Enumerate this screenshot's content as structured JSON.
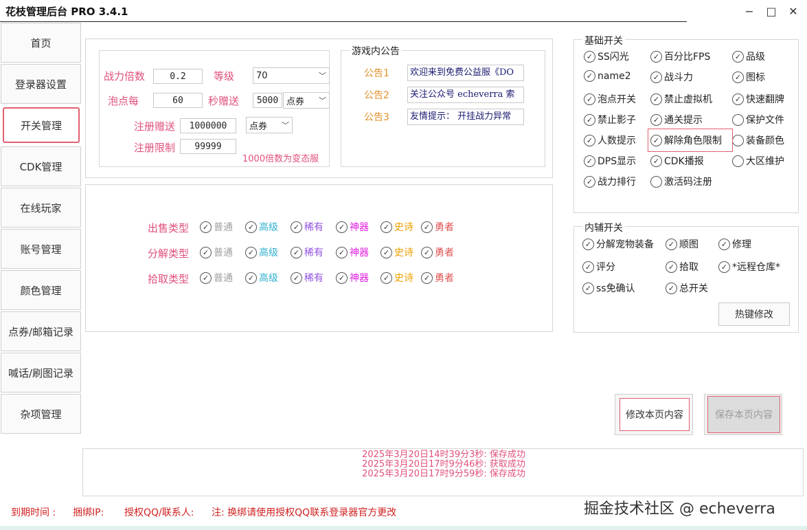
{
  "window": {
    "title": "花枝管理后台 PRO 3.4.1",
    "min": "−",
    "max": "□",
    "close": "✕"
  },
  "nav": [
    "首页",
    "登录器设置",
    "开关管理",
    "CDK管理",
    "在线玩家",
    "账号管理",
    "颜色管理",
    "点券/邮箱记录",
    "喊话/刷图记录",
    "杂项管理"
  ],
  "settings": {
    "power_mult_label": "战力倍数",
    "power_mult_value": "0.2",
    "level_label": "等级",
    "level_value": "70",
    "bubble_label": "泡点每",
    "bubble_value": "60",
    "per_sec_label": "秒赠送",
    "per_sec_value": "5000",
    "currency_value": "点券",
    "reg_gift_label": "注册赠送",
    "reg_gift_value": "1000000",
    "reg_currency_value": "点券",
    "reg_limit_label": "注册限制",
    "reg_limit_value": "99999",
    "hint": "1000倍数为变态服"
  },
  "announce": {
    "title": "游戏内公告",
    "items": [
      {
        "label": "公告1",
        "value": "欢迎来到免费公益服《DO"
      },
      {
        "label": "公告2",
        "value": "关注公众号 echeverra 索"
      },
      {
        "label": "公告3",
        "value": "友情提示： 开挂战力异常"
      }
    ]
  },
  "types": {
    "rows": [
      "出售类型",
      "分解类型",
      "拾取类型"
    ],
    "options": [
      {
        "label": "普通",
        "color": "#a0a0a0"
      },
      {
        "label": "高级",
        "color": "#30b0d0"
      },
      {
        "label": "稀有",
        "color": "#9050e0"
      },
      {
        "label": "神器",
        "color": "#e020e0"
      },
      {
        "label": "史诗",
        "color": "#f0a000"
      },
      {
        "label": "勇者",
        "color": "#e05050"
      }
    ]
  },
  "basic": {
    "title": "基础开关",
    "items": [
      {
        "label": "SS闪光",
        "checked": true
      },
      {
        "label": "百分比FPS",
        "checked": true
      },
      {
        "label": "品级",
        "checked": true
      },
      {
        "label": "name2",
        "checked": true
      },
      {
        "label": "战斗力",
        "checked": true
      },
      {
        "label": "图标",
        "checked": true
      },
      {
        "label": "泡点开关",
        "checked": true
      },
      {
        "label": "禁止虚拟机",
        "checked": true
      },
      {
        "label": "快速翻牌",
        "checked": true
      },
      {
        "label": "禁止影子",
        "checked": true
      },
      {
        "label": "通关提示",
        "checked": true
      },
      {
        "label": "保护文件",
        "checked": false
      },
      {
        "label": "人数提示",
        "checked": true
      },
      {
        "label": "解除角色限制",
        "checked": true
      },
      {
        "label": "装备颜色",
        "checked": false
      },
      {
        "label": "DPS显示",
        "checked": true
      },
      {
        "label": "CDK播报",
        "checked": true
      },
      {
        "label": "大区维护",
        "checked": false
      },
      {
        "label": "战力排行",
        "checked": true
      },
      {
        "label": "激活码注册",
        "checked": false
      }
    ]
  },
  "aux": {
    "title": "内辅开关",
    "items": [
      {
        "label": "分解宠物装备",
        "checked": true
      },
      {
        "label": "顺图",
        "checked": true
      },
      {
        "label": "修理",
        "checked": true
      },
      {
        "label": "评分",
        "checked": true
      },
      {
        "label": "拾取",
        "checked": true
      },
      {
        "label": "*远程仓库*",
        "checked": true
      },
      {
        "label": "ss免确认",
        "checked": true
      },
      {
        "label": "总开关",
        "checked": true
      }
    ],
    "hotkey_button": "热键修改"
  },
  "actions": {
    "modify": "修改本页内容",
    "save": "保存本页内容"
  },
  "log": [
    "2025年3月20日14时39分3秒: 保存成功",
    "2025年3月20日17时9分46秒: 获取成功",
    "2025年3月20日17时9分59秒: 保存成功"
  ],
  "footer": {
    "expire": "到期时间 :",
    "bind_ip": "捆绑IP:",
    "qq": "授权QQ/联系人:",
    "note": "注: 换绑请使用授权QQ联系登录器官方更改"
  },
  "watermark": "掘金技术社区 @ echeverra"
}
